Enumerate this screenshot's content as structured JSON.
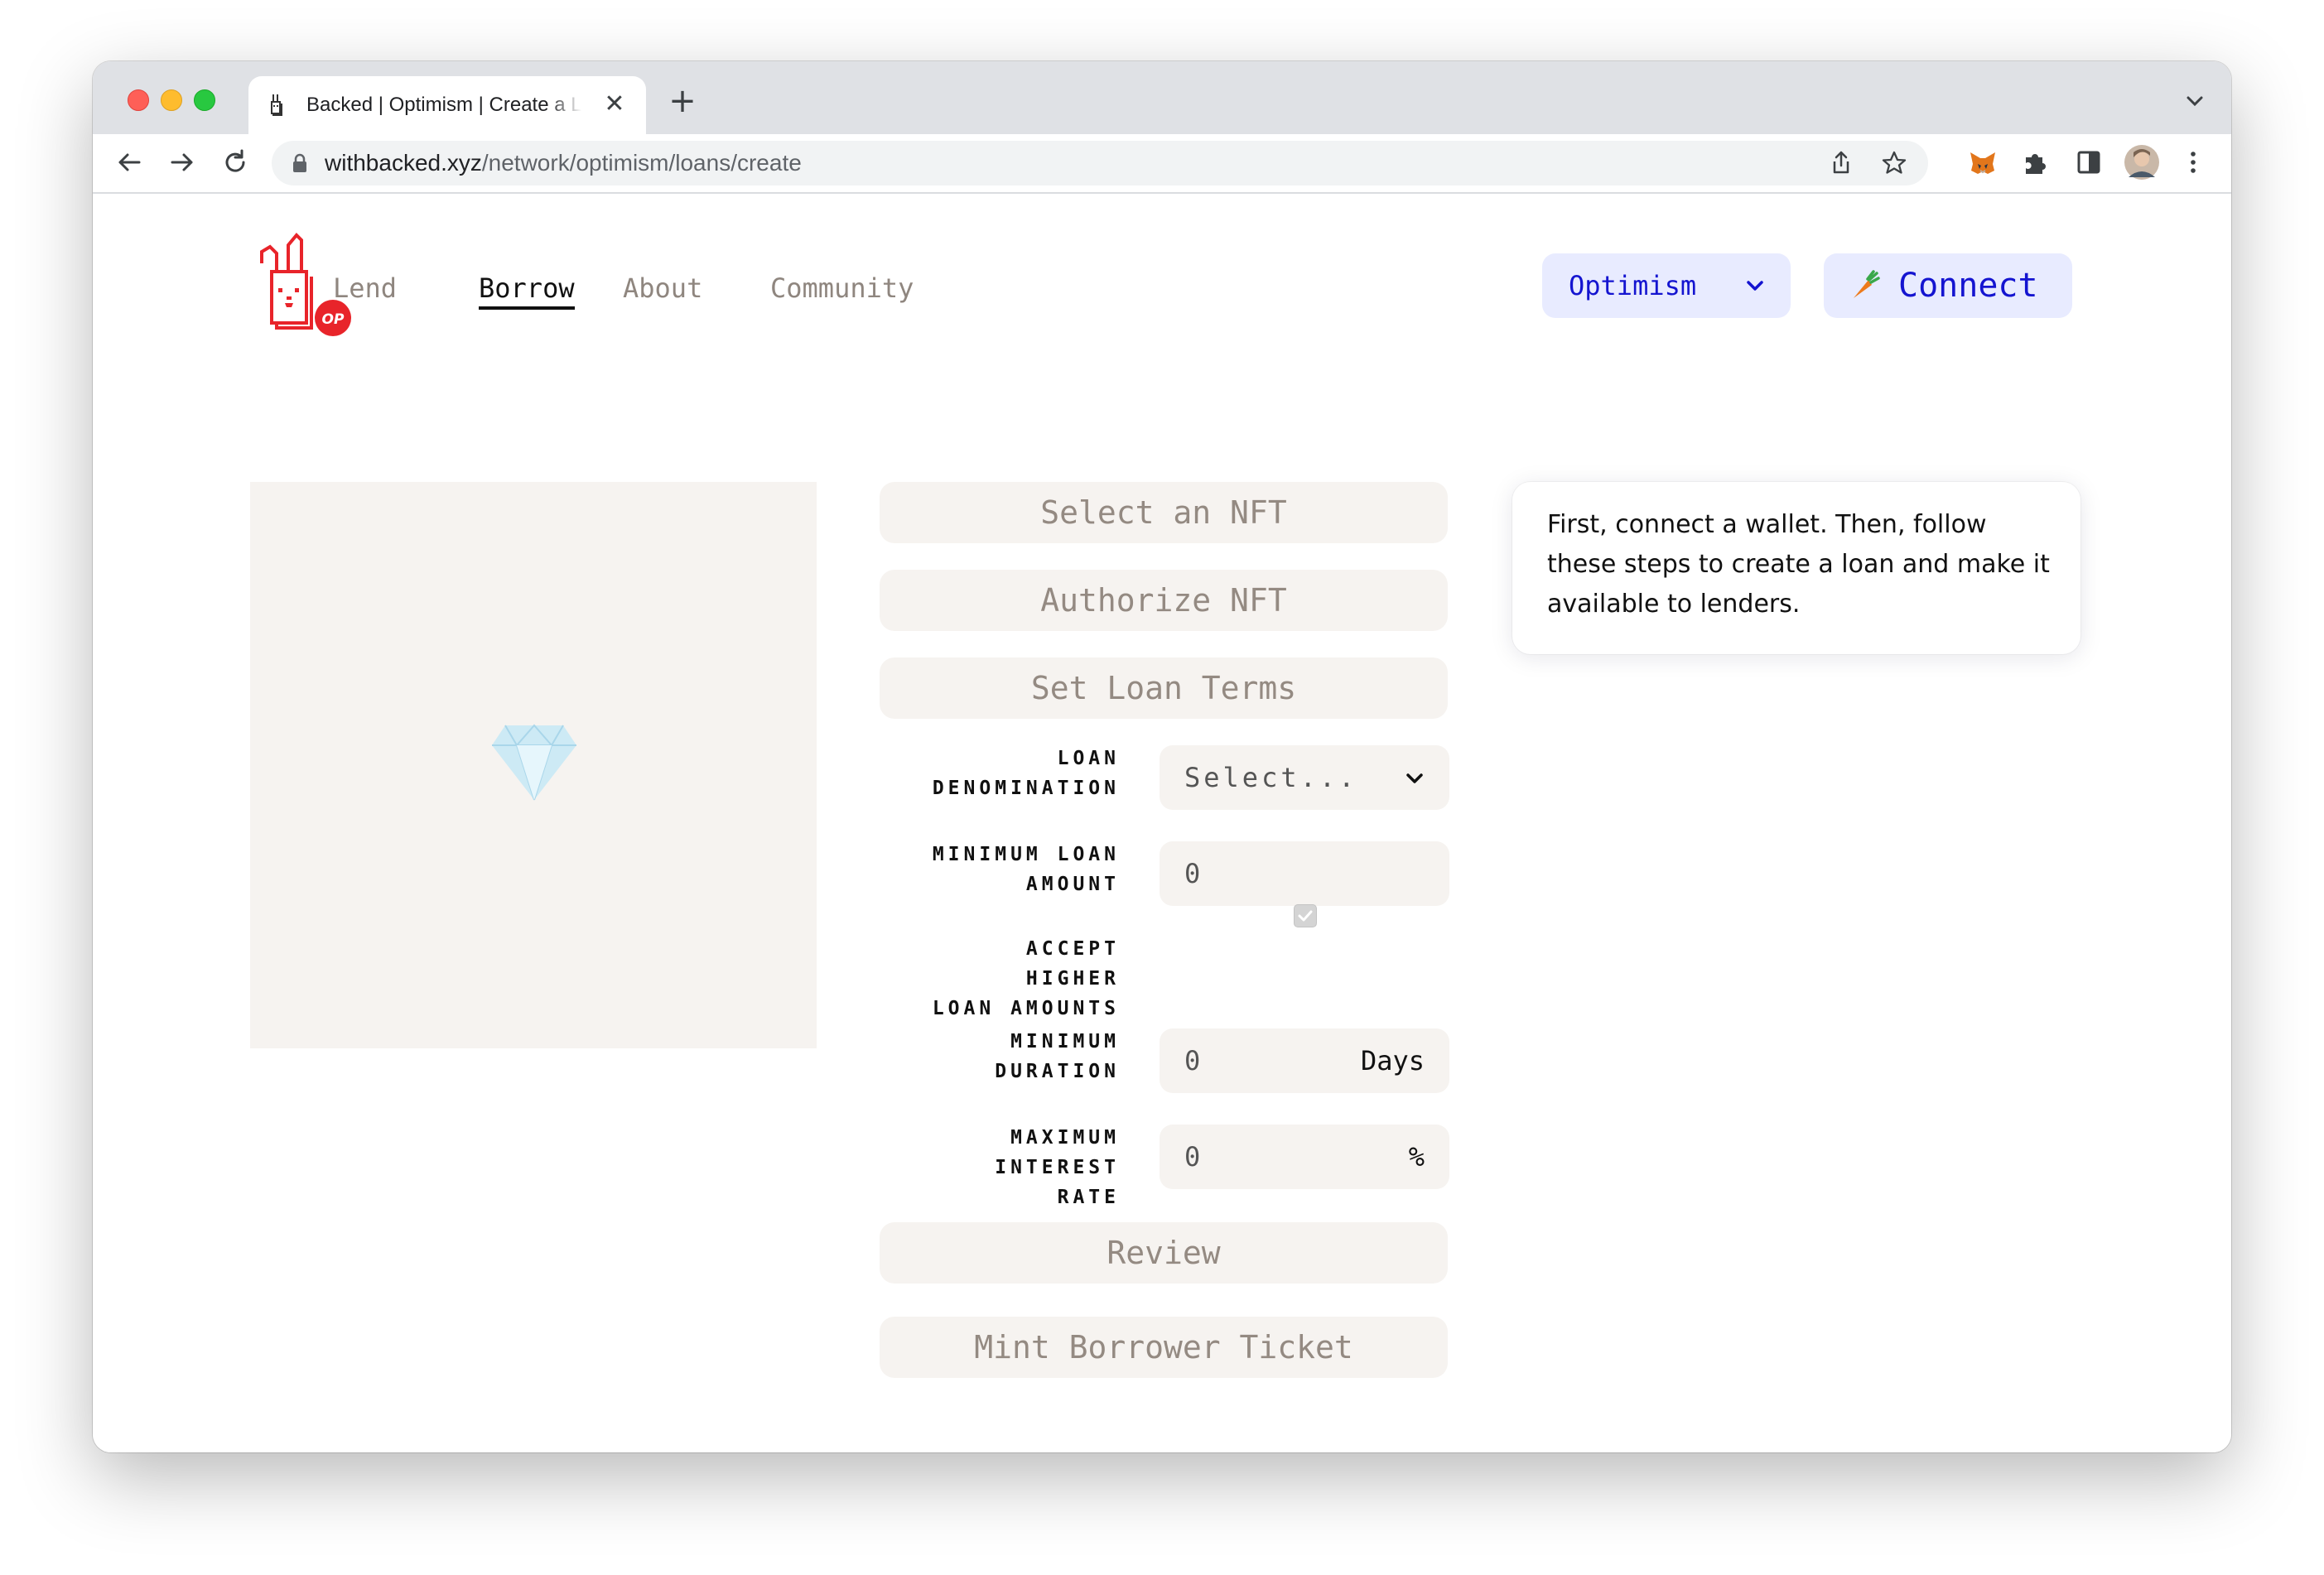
{
  "browser": {
    "tab_title": "Backed | Optimism | Create a Loan",
    "url_host": "withbacked.xyz",
    "url_path": "/network/optimism/loans/create"
  },
  "nav": {
    "logo_badge": "OP",
    "items": [
      {
        "label": "Lend",
        "active": false
      },
      {
        "label": "Borrow",
        "active": true
      },
      {
        "label": "About",
        "active": false
      },
      {
        "label": "Community",
        "active": false
      }
    ],
    "network_label": "Optimism",
    "connect_label": "Connect"
  },
  "steps": {
    "select_nft": "Select an NFT",
    "authorize_nft": "Authorize NFT",
    "set_loan_terms": "Set Loan Terms",
    "review": "Review",
    "mint_ticket": "Mint Borrower Ticket"
  },
  "form": {
    "denomination": {
      "label_1": "LOAN",
      "label_2": "DENOMINATION",
      "value": "Select..."
    },
    "min_loan_amount": {
      "label_1": "MINIMUM LOAN",
      "label_2": "AMOUNT",
      "value": "0"
    },
    "accept_higher": {
      "label_1": "ACCEPT HIGHER",
      "label_2": "LOAN AMOUNTS",
      "checked": true
    },
    "min_duration": {
      "label_1": "MINIMUM",
      "label_2": "DURATION",
      "value": "0",
      "unit": "Days"
    },
    "max_interest": {
      "label_1": "MAXIMUM",
      "label_2": "INTEREST RATE",
      "value": "0",
      "unit": "%"
    }
  },
  "info": {
    "text": "First, connect a wallet. Then, follow these steps to create a loan and make it available to lenders."
  },
  "colors": {
    "accent_blue": "#1414d0",
    "pill_bg": "#e8ebff",
    "logo_red": "#e8242a",
    "muted_bg": "#f6f3f0"
  }
}
